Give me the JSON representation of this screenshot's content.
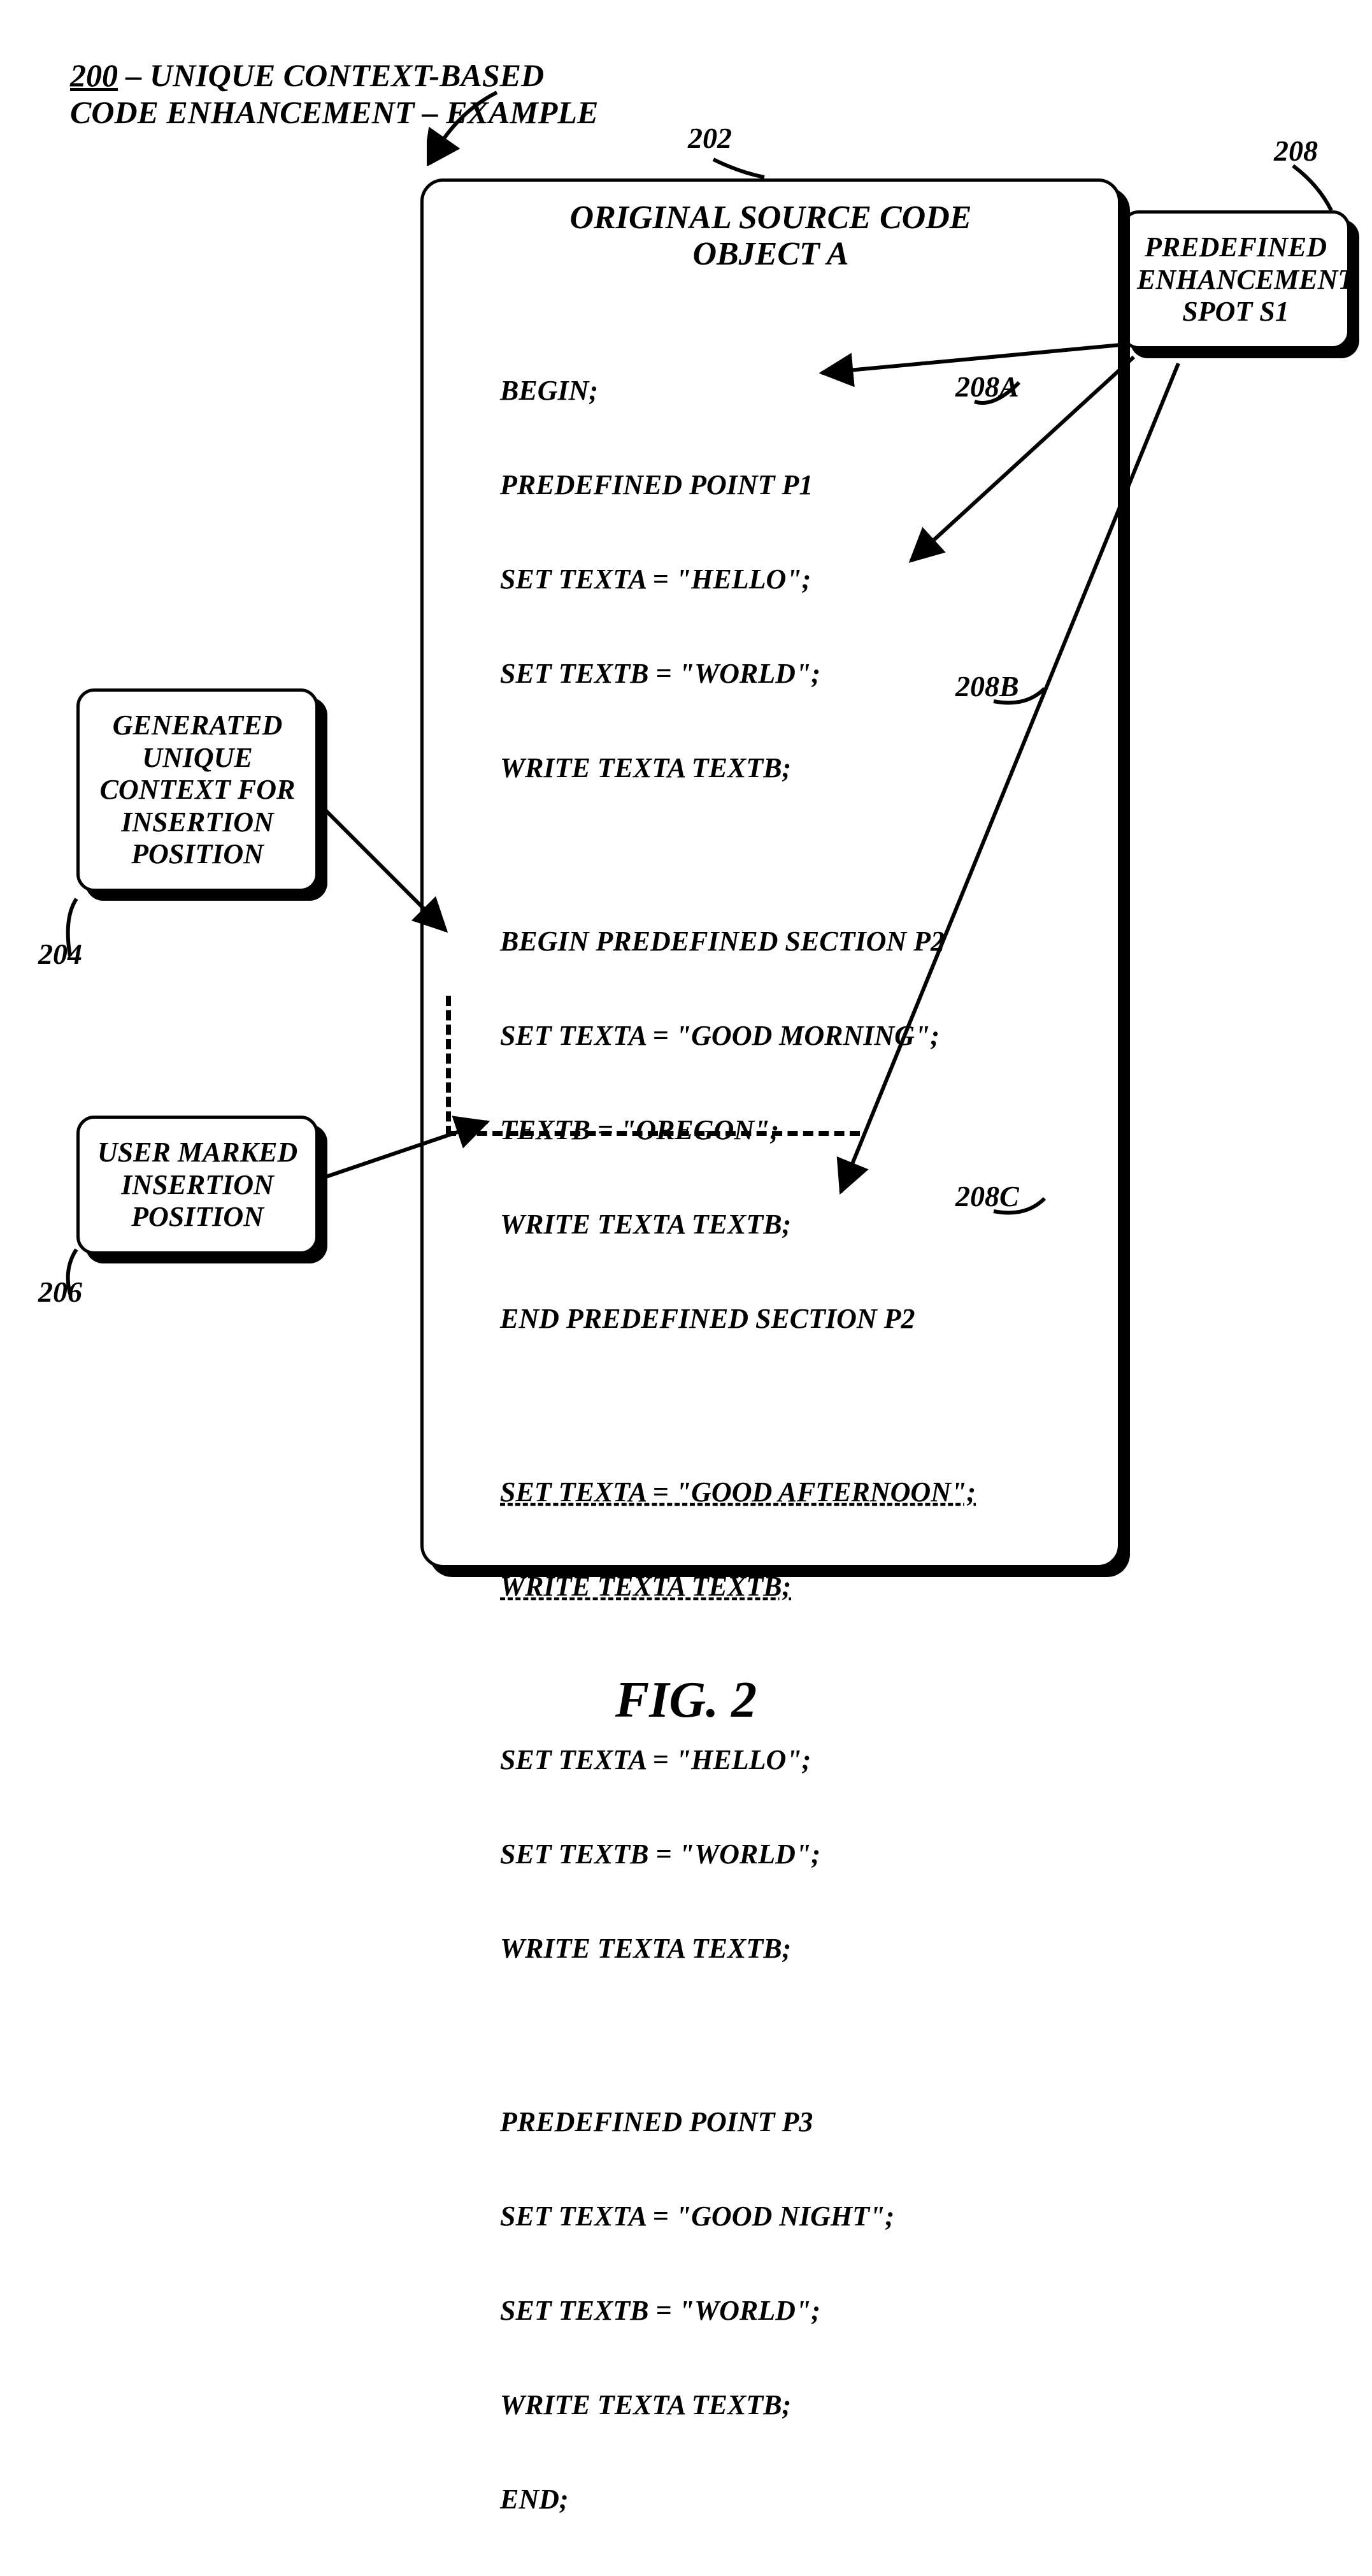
{
  "title": {
    "num": "200",
    "line1_rest": " – UNIQUE CONTEXT-BASED",
    "line2": "CODE ENHANCEMENT – EXAMPLE"
  },
  "refs": {
    "r202": "202",
    "r204": "204",
    "r206": "206",
    "r208": "208",
    "r208a": "208A",
    "r208b": "208B",
    "r208c": "208C"
  },
  "boxes": {
    "generated_context": "GENERATED\nUNIQUE\nCONTEXT FOR\nINSERTION\nPOSITION",
    "user_marked": "USER MARKED\nINSERTION\nPOSITION",
    "predefined_spot": "PREDEFINED\nENHANCEMENT\nSPOT S1"
  },
  "main": {
    "title_l1": "ORIGINAL SOURCE CODE",
    "title_l2": "OBJECT A"
  },
  "code": {
    "l01": "BEGIN;",
    "l02": "PREDEFINED POINT P1",
    "l03": "SET TEXTA = \"HELLO\";",
    "l04": "SET TEXTB = \"WORLD\";",
    "l05": "WRITE TEXTA TEXTB;",
    "l06": "BEGIN PREDEFINED SECTION P2",
    "l07": "SET TEXTA = \"GOOD MORNING\";",
    "l08": "TEXTB = \"OREGON\";",
    "l09": "WRITE TEXTA TEXTB;",
    "l10": "END PREDEFINED SECTION P2",
    "l11": "SET TEXTA = \"GOOD AFTERNOON\";",
    "l12": "WRITE TEXTA TEXTB;",
    "l13": "SET TEXTA = \"HELLO\";",
    "l14": "SET TEXTB = \"WORLD\";",
    "l15": "WRITE TEXTA TEXTB;",
    "l16": "PREDEFINED POINT P3",
    "l17": "SET TEXTA = \"GOOD NIGHT\";",
    "l18": "SET TEXTB = \"WORLD\";",
    "l19": "WRITE TEXTA TEXTB;",
    "l20": "END;"
  },
  "fig": "FIG. 2"
}
